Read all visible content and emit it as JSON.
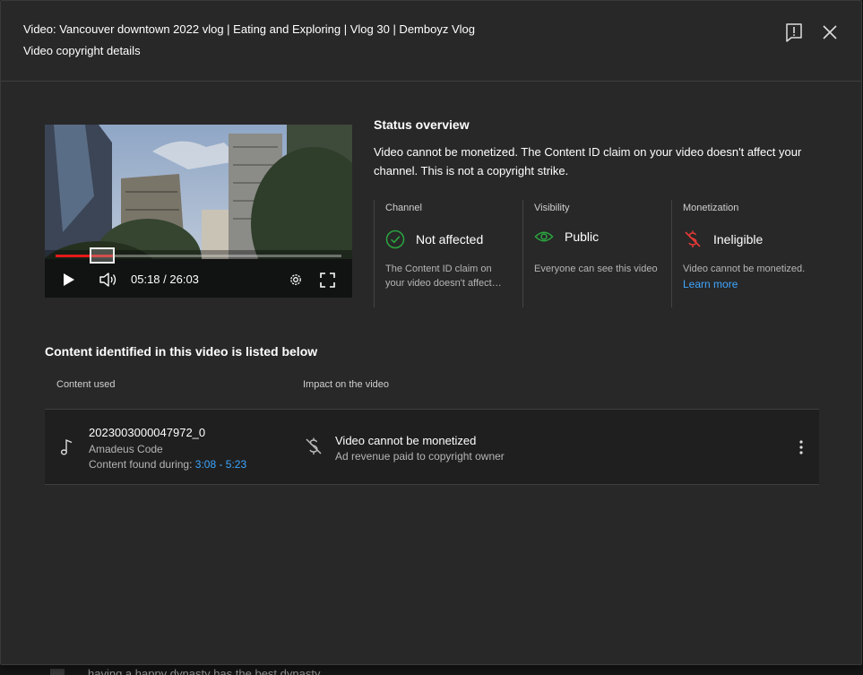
{
  "header": {
    "title": "Video: Vancouver downtown 2022 vlog | Eating and Exploring | Vlog 30 | Demboyz Vlog",
    "subtitle": "Video copyright details",
    "feedback_icon": "feedback-icon",
    "close_icon": "close-icon"
  },
  "player": {
    "time": "05:18 / 26:03",
    "progress": 0.204,
    "controls": [
      "play-icon",
      "volume-icon",
      "settings-icon",
      "fullscreen-icon"
    ]
  },
  "status": {
    "title": "Status overview",
    "description": "Video cannot be monetized. The Content ID claim on your video doesn't affect your channel. This is not a copyright strike.",
    "columns": [
      {
        "label": "Channel",
        "value": "Not affected",
        "icon": "check-circle-icon",
        "description": "The Content ID claim on your video doesn't affect your channel.",
        "color": "#2ba640"
      },
      {
        "label": "Visibility",
        "value": "Public",
        "icon": "eye-icon",
        "description": "Everyone can see this video",
        "color": "#2ba640"
      },
      {
        "label": "Monetization",
        "value": "Ineligible",
        "icon": "no-monetization-icon",
        "description": "Video cannot be monetized.",
        "link": "Learn more",
        "color": "#e53935"
      }
    ]
  },
  "content": {
    "title": "Content identified in this video is listed below",
    "headers": {
      "used": "Content used",
      "impact": "Impact on the video"
    },
    "rows": [
      {
        "asset_id": "2023003000047972_0",
        "owner": "Amadeus Code",
        "found_label": "Content found during:",
        "range": "3:08 - 5:23",
        "impact_title": "Video cannot be monetized",
        "impact_sub": "Ad revenue paid to copyright owner",
        "icon": "music-note-icon",
        "impact_icon": "no-monetization-icon"
      }
    ]
  },
  "backdrop": {
    "text": "having a happy dynasty has the best dynasty"
  },
  "colors": {
    "accent_link": "#3ea6ff",
    "progress": "#e41a1a",
    "success": "#2ba640",
    "error": "#e53935",
    "dialog_bg": "#282828"
  }
}
